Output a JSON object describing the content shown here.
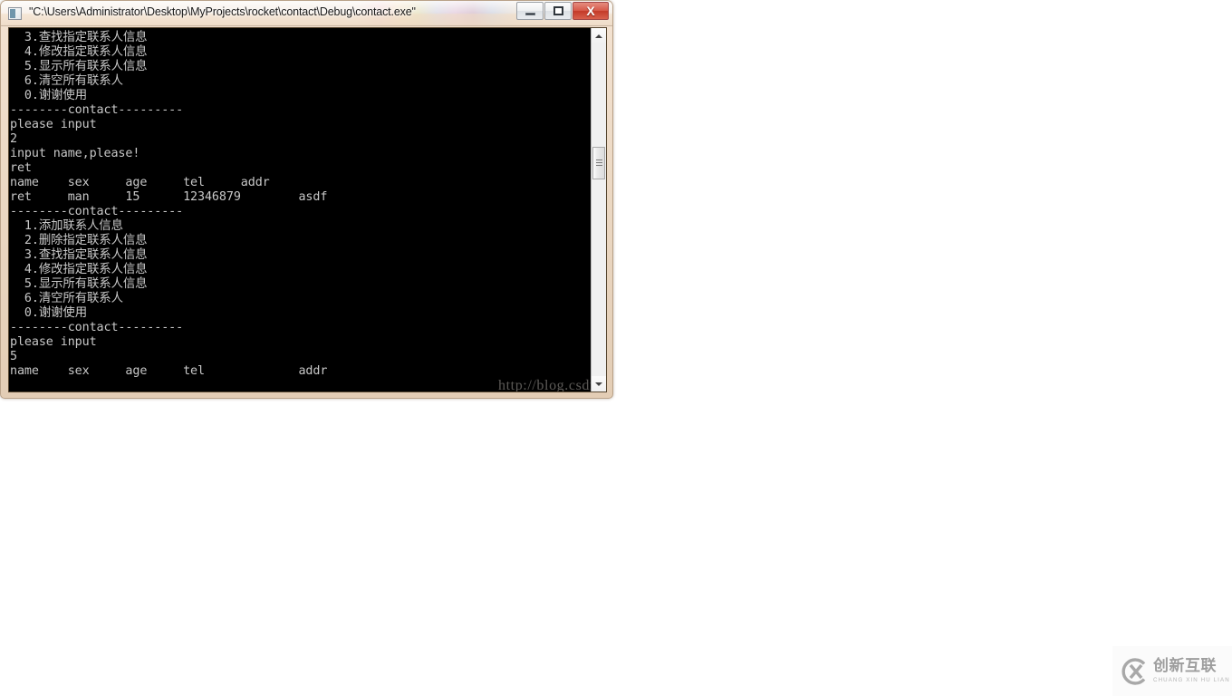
{
  "window": {
    "title": "\"C:\\Users\\Administrator\\Desktop\\MyProjects\\rocket\\contact\\Debug\\contact.exe\"",
    "icon_name": "console-app-icon",
    "controls": {
      "minimize_label": "–",
      "maximize_label": "□",
      "close_label": "X"
    }
  },
  "console": {
    "foreground_color": "#c8c8c8",
    "background_color": "#000000",
    "lines": [
      "  3.查找指定联系人信息",
      "  4.修改指定联系人信息",
      "  5.显示所有联系人信息",
      "  6.清空所有联系人",
      "  0.谢谢使用",
      "--------contact---------",
      "please input",
      "2",
      "input name,please!",
      "ret",
      "name    sex     age     tel     addr",
      "ret     man     15      12346879        asdf",
      "--------contact---------",
      "  1.添加联系人信息",
      "  2.删除指定联系人信息",
      "  3.查找指定联系人信息",
      "  4.修改指定联系人信息",
      "  5.显示所有联系人信息",
      "  6.清空所有联系人",
      "  0.谢谢使用",
      "--------contact---------",
      "please input",
      "5",
      "name    sex     age     tel             addr"
    ],
    "scrollbar": {
      "up_arrow_name": "scroll-up-arrow",
      "down_arrow_name": "scroll-down-arrow",
      "thumb_name": "scroll-thumb"
    }
  },
  "watermark": {
    "text": "http://blog.csdn.net/ret_skd"
  },
  "brand": {
    "chinese": "创新互联",
    "pinyin": "CHUANG XIN HU LIAN"
  }
}
